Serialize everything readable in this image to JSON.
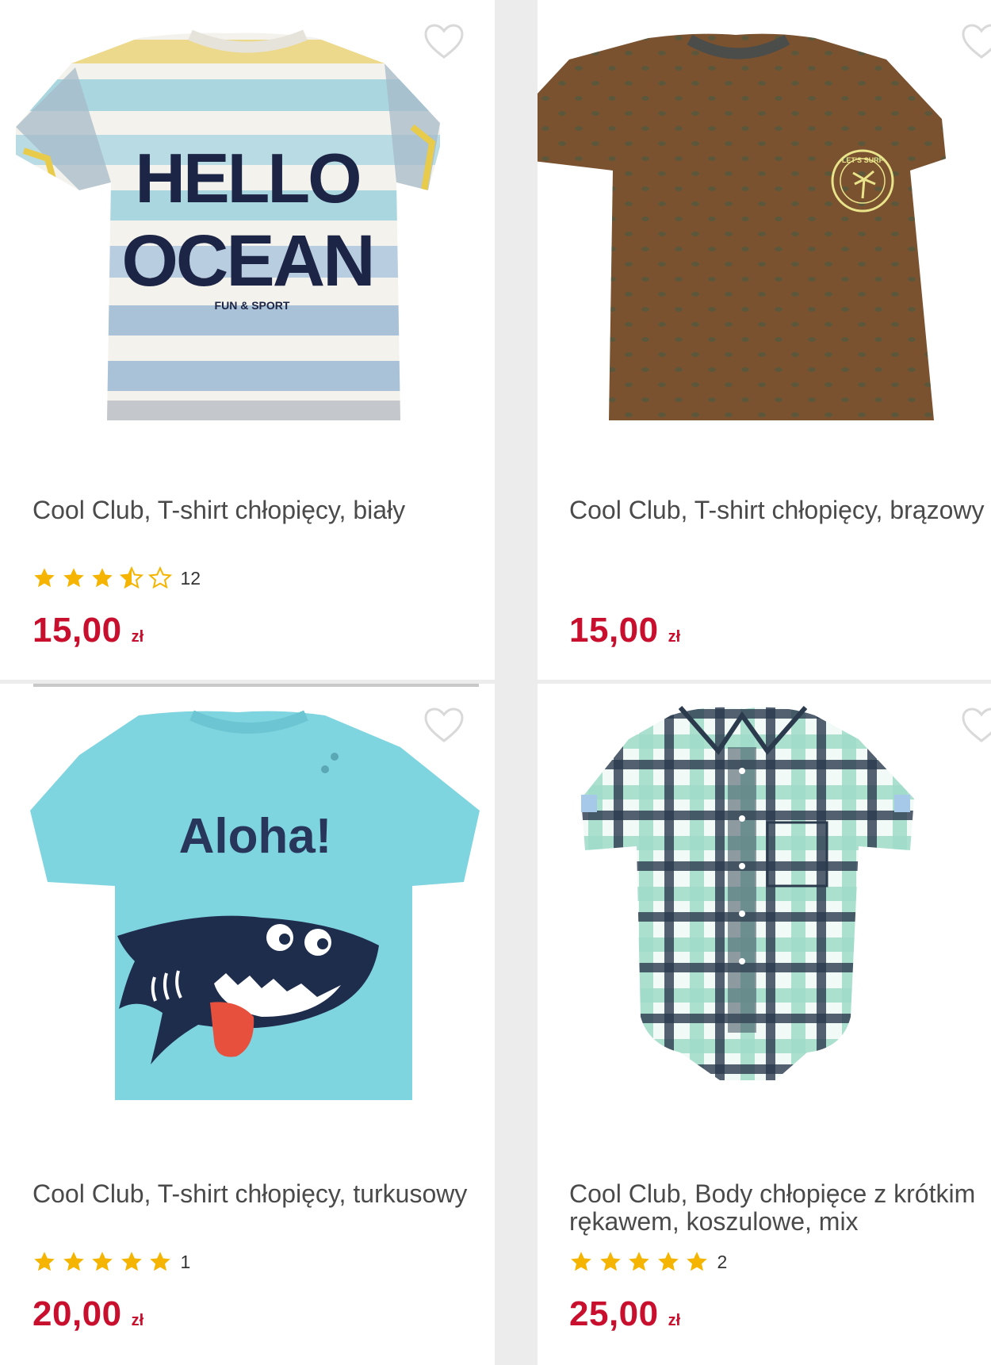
{
  "products": [
    {
      "name": "Cool Club, T-shirt chłopięcy, biały",
      "price": "15,00",
      "currency": "zł",
      "rating": 3.5,
      "rating_count": "12",
      "shirt_print_line1": "HELLO",
      "shirt_print_line2": "OCEAN",
      "shirt_print_small": "FUN & SPORT"
    },
    {
      "name": "Cool Club, T-shirt chłopięcy, brązowy",
      "price": "15,00",
      "currency": "zł",
      "badge_text": "LET'S SURF"
    },
    {
      "name": "Cool Club, T-shirt chłopięcy, turkusowy",
      "price": "20,00",
      "currency": "zł",
      "rating": 5,
      "rating_count": "1",
      "shirt_print": "Aloha!"
    },
    {
      "name": "Cool Club, Body chłopięce z krótkim rękawem, koszulowe, mix",
      "price": "25,00",
      "currency": "zł",
      "rating": 5,
      "rating_count": "2"
    }
  ],
  "colors": {
    "price": "#c8102e",
    "star": "#f5b400",
    "title": "#4a4a4a",
    "heart_outline": "#d9d9d9"
  }
}
